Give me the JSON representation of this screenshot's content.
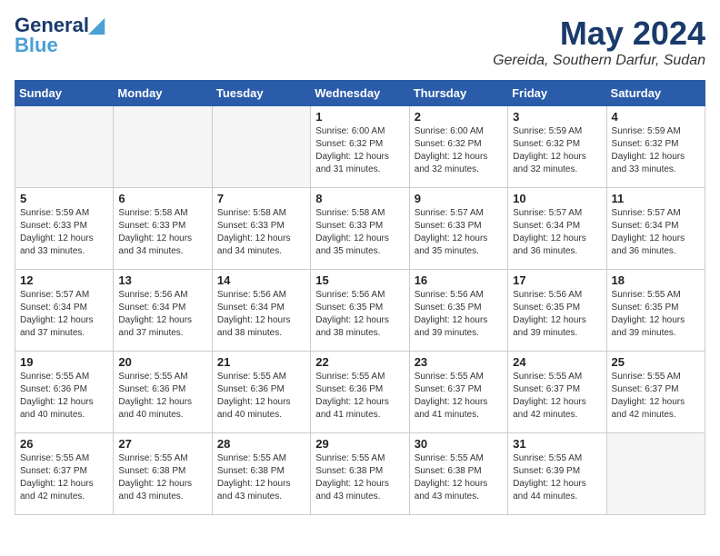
{
  "header": {
    "logo_line1": "General",
    "logo_line2": "Blue",
    "month_year": "May 2024",
    "location": "Gereida, Southern Darfur, Sudan"
  },
  "weekdays": [
    "Sunday",
    "Monday",
    "Tuesday",
    "Wednesday",
    "Thursday",
    "Friday",
    "Saturday"
  ],
  "weeks": [
    [
      {
        "day": "",
        "info": ""
      },
      {
        "day": "",
        "info": ""
      },
      {
        "day": "",
        "info": ""
      },
      {
        "day": "1",
        "info": "Sunrise: 6:00 AM\nSunset: 6:32 PM\nDaylight: 12 hours\nand 31 minutes."
      },
      {
        "day": "2",
        "info": "Sunrise: 6:00 AM\nSunset: 6:32 PM\nDaylight: 12 hours\nand 32 minutes."
      },
      {
        "day": "3",
        "info": "Sunrise: 5:59 AM\nSunset: 6:32 PM\nDaylight: 12 hours\nand 32 minutes."
      },
      {
        "day": "4",
        "info": "Sunrise: 5:59 AM\nSunset: 6:32 PM\nDaylight: 12 hours\nand 33 minutes."
      }
    ],
    [
      {
        "day": "5",
        "info": "Sunrise: 5:59 AM\nSunset: 6:33 PM\nDaylight: 12 hours\nand 33 minutes."
      },
      {
        "day": "6",
        "info": "Sunrise: 5:58 AM\nSunset: 6:33 PM\nDaylight: 12 hours\nand 34 minutes."
      },
      {
        "day": "7",
        "info": "Sunrise: 5:58 AM\nSunset: 6:33 PM\nDaylight: 12 hours\nand 34 minutes."
      },
      {
        "day": "8",
        "info": "Sunrise: 5:58 AM\nSunset: 6:33 PM\nDaylight: 12 hours\nand 35 minutes."
      },
      {
        "day": "9",
        "info": "Sunrise: 5:57 AM\nSunset: 6:33 PM\nDaylight: 12 hours\nand 35 minutes."
      },
      {
        "day": "10",
        "info": "Sunrise: 5:57 AM\nSunset: 6:34 PM\nDaylight: 12 hours\nand 36 minutes."
      },
      {
        "day": "11",
        "info": "Sunrise: 5:57 AM\nSunset: 6:34 PM\nDaylight: 12 hours\nand 36 minutes."
      }
    ],
    [
      {
        "day": "12",
        "info": "Sunrise: 5:57 AM\nSunset: 6:34 PM\nDaylight: 12 hours\nand 37 minutes."
      },
      {
        "day": "13",
        "info": "Sunrise: 5:56 AM\nSunset: 6:34 PM\nDaylight: 12 hours\nand 37 minutes."
      },
      {
        "day": "14",
        "info": "Sunrise: 5:56 AM\nSunset: 6:34 PM\nDaylight: 12 hours\nand 38 minutes."
      },
      {
        "day": "15",
        "info": "Sunrise: 5:56 AM\nSunset: 6:35 PM\nDaylight: 12 hours\nand 38 minutes."
      },
      {
        "day": "16",
        "info": "Sunrise: 5:56 AM\nSunset: 6:35 PM\nDaylight: 12 hours\nand 39 minutes."
      },
      {
        "day": "17",
        "info": "Sunrise: 5:56 AM\nSunset: 6:35 PM\nDaylight: 12 hours\nand 39 minutes."
      },
      {
        "day": "18",
        "info": "Sunrise: 5:55 AM\nSunset: 6:35 PM\nDaylight: 12 hours\nand 39 minutes."
      }
    ],
    [
      {
        "day": "19",
        "info": "Sunrise: 5:55 AM\nSunset: 6:36 PM\nDaylight: 12 hours\nand 40 minutes."
      },
      {
        "day": "20",
        "info": "Sunrise: 5:55 AM\nSunset: 6:36 PM\nDaylight: 12 hours\nand 40 minutes."
      },
      {
        "day": "21",
        "info": "Sunrise: 5:55 AM\nSunset: 6:36 PM\nDaylight: 12 hours\nand 40 minutes."
      },
      {
        "day": "22",
        "info": "Sunrise: 5:55 AM\nSunset: 6:36 PM\nDaylight: 12 hours\nand 41 minutes."
      },
      {
        "day": "23",
        "info": "Sunrise: 5:55 AM\nSunset: 6:37 PM\nDaylight: 12 hours\nand 41 minutes."
      },
      {
        "day": "24",
        "info": "Sunrise: 5:55 AM\nSunset: 6:37 PM\nDaylight: 12 hours\nand 42 minutes."
      },
      {
        "day": "25",
        "info": "Sunrise: 5:55 AM\nSunset: 6:37 PM\nDaylight: 12 hours\nand 42 minutes."
      }
    ],
    [
      {
        "day": "26",
        "info": "Sunrise: 5:55 AM\nSunset: 6:37 PM\nDaylight: 12 hours\nand 42 minutes."
      },
      {
        "day": "27",
        "info": "Sunrise: 5:55 AM\nSunset: 6:38 PM\nDaylight: 12 hours\nand 43 minutes."
      },
      {
        "day": "28",
        "info": "Sunrise: 5:55 AM\nSunset: 6:38 PM\nDaylight: 12 hours\nand 43 minutes."
      },
      {
        "day": "29",
        "info": "Sunrise: 5:55 AM\nSunset: 6:38 PM\nDaylight: 12 hours\nand 43 minutes."
      },
      {
        "day": "30",
        "info": "Sunrise: 5:55 AM\nSunset: 6:38 PM\nDaylight: 12 hours\nand 43 minutes."
      },
      {
        "day": "31",
        "info": "Sunrise: 5:55 AM\nSunset: 6:39 PM\nDaylight: 12 hours\nand 44 minutes."
      },
      {
        "day": "",
        "info": ""
      }
    ]
  ]
}
